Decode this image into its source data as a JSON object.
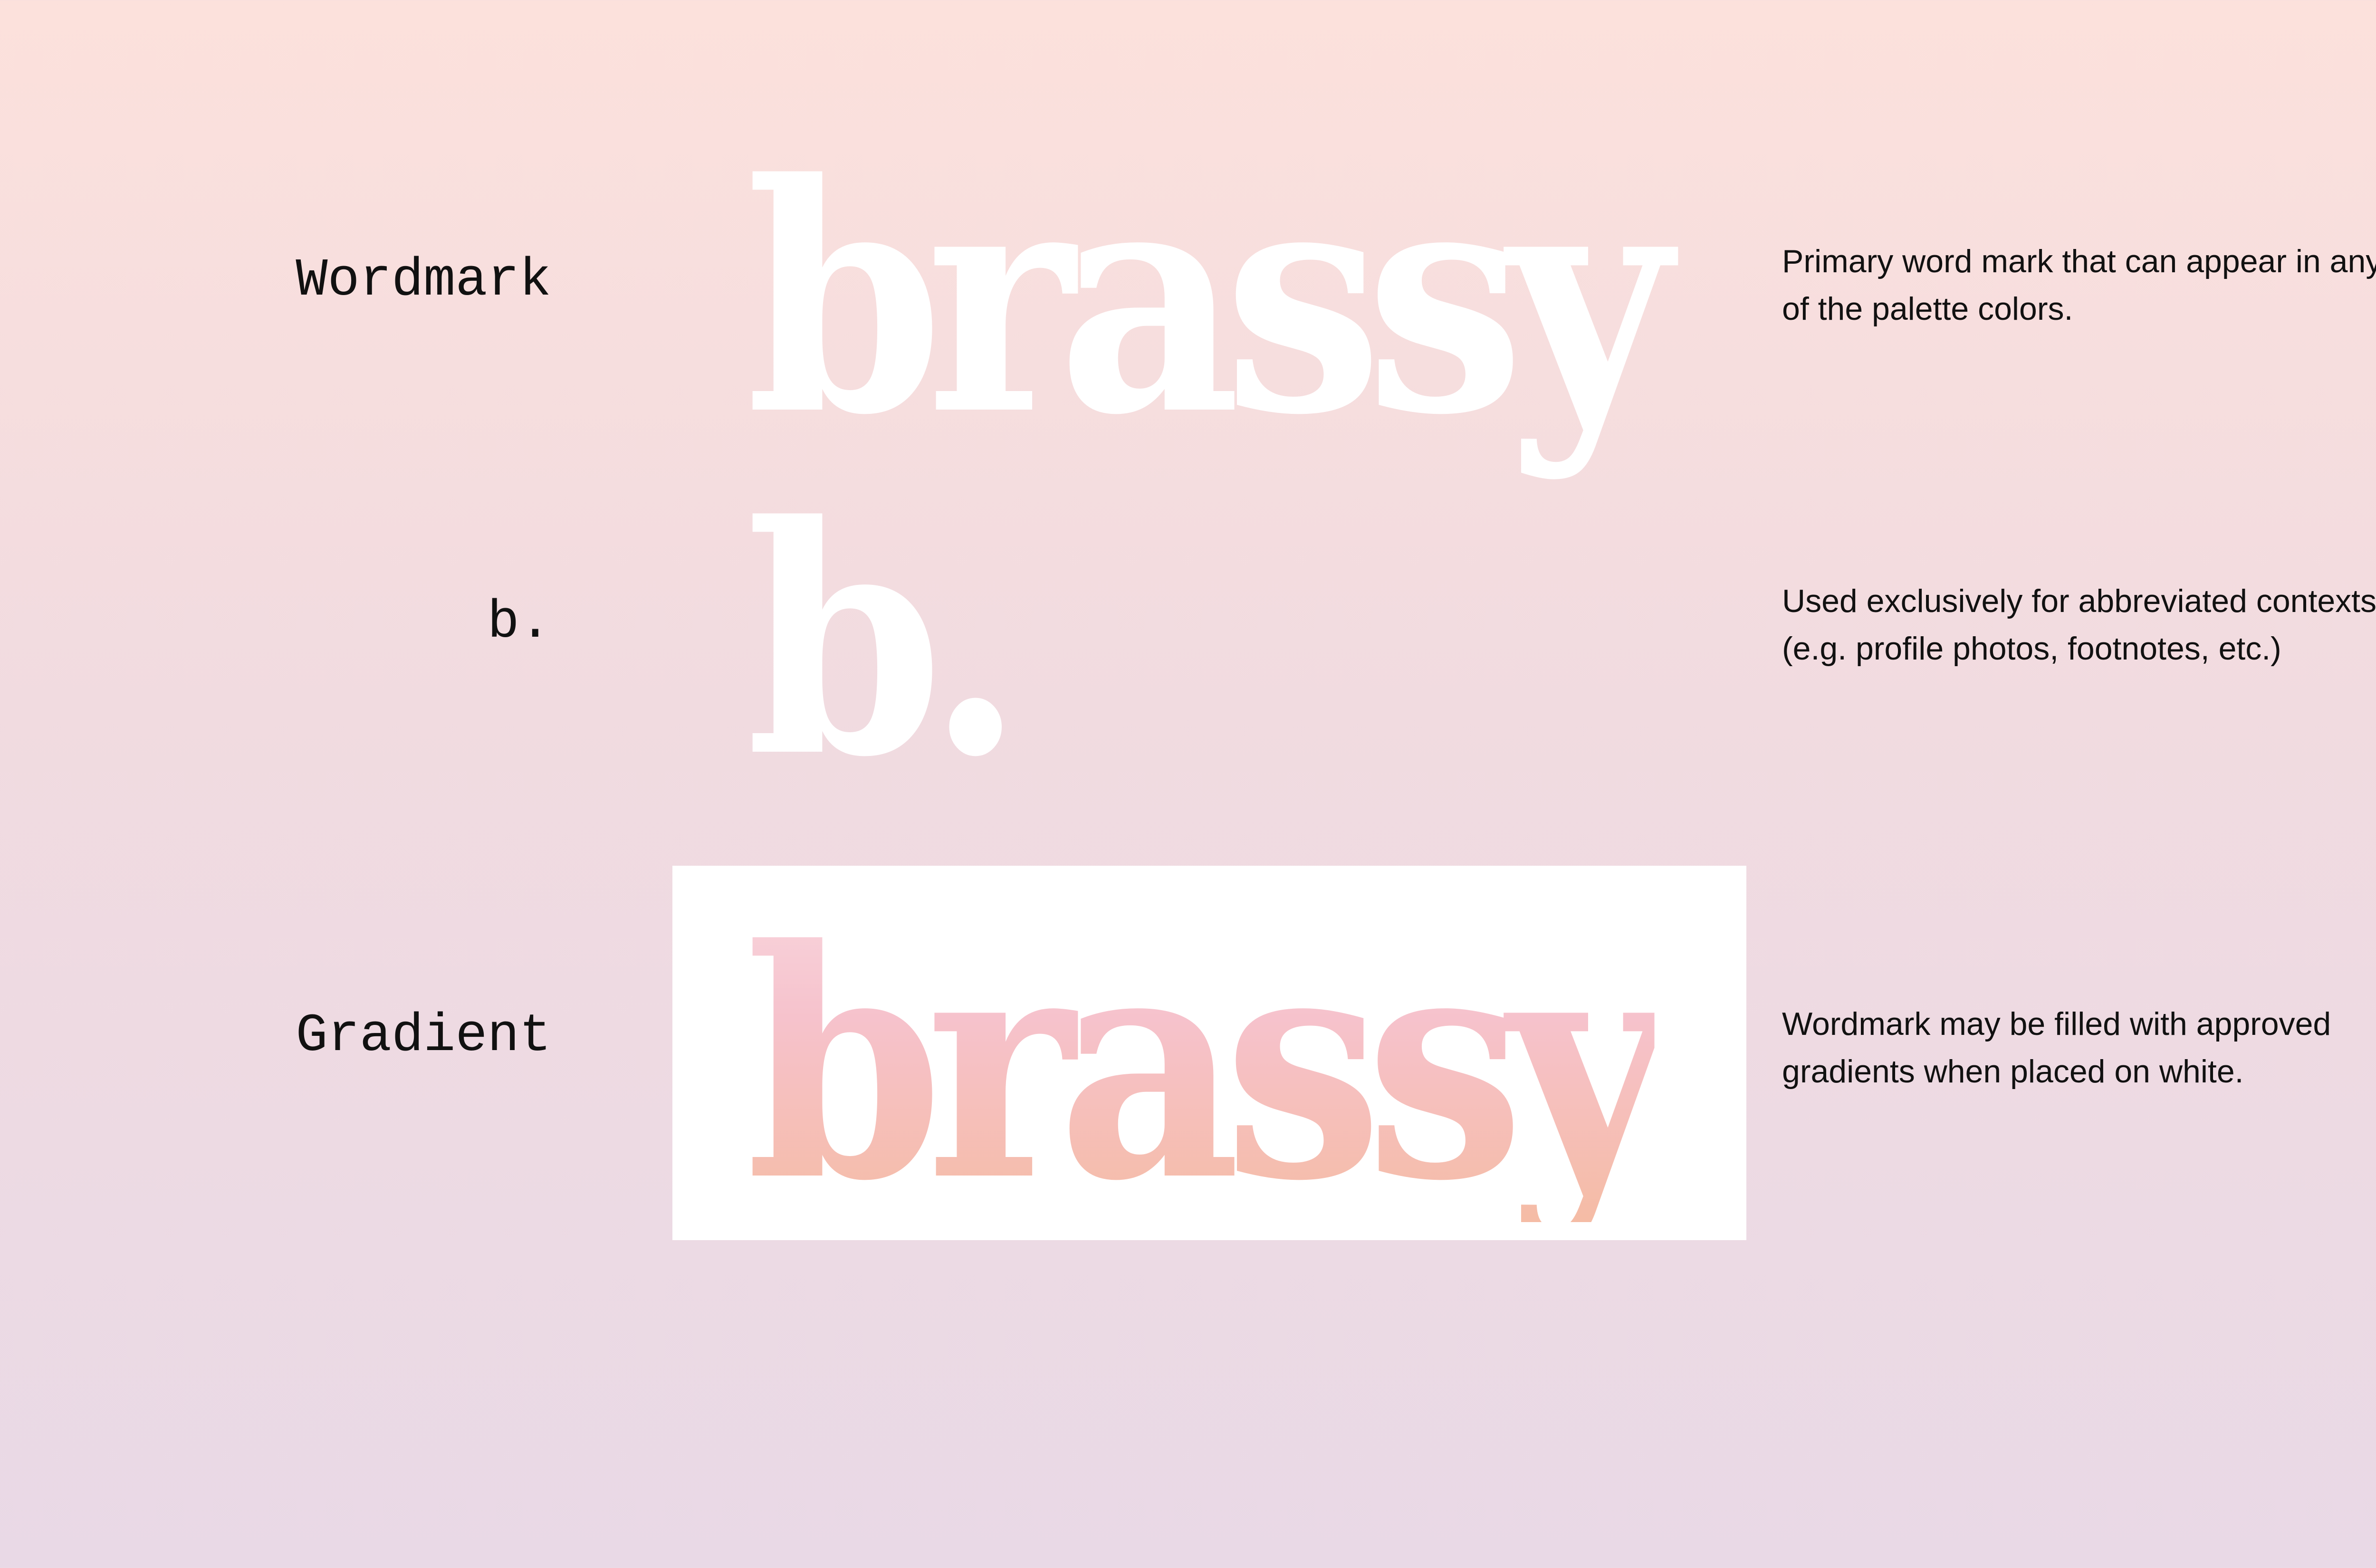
{
  "rows": [
    {
      "label": "Wordmark",
      "mark": "brassy",
      "description_lines": [
        "Primary word mark that can appear in any",
        "of the palette colors."
      ]
    },
    {
      "label": "b.",
      "mark": "b.",
      "description_lines": [
        "Used exclusively for abbreviated contexts.",
        "(e.g. profile photos, footnotes, etc.)"
      ]
    },
    {
      "label": "Gradient",
      "mark": "brassy",
      "description_lines": [
        "Wordmark may be filled with approved",
        "gradients when placed on white."
      ]
    }
  ],
  "colors": {
    "background_top": "#fce1dc",
    "background_bottom": "#e9d9e6",
    "mark": "#ffffff",
    "gradient_top": "#f8d3db",
    "gradient_bottom": "#f5bca5",
    "panel": "#ffffff",
    "text": "#111111"
  }
}
